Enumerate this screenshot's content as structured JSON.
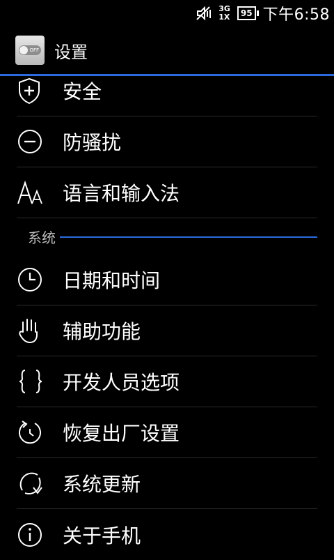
{
  "status_bar": {
    "network_top": "3G",
    "network_bottom": "1X",
    "battery": "95",
    "time": "下午6:58"
  },
  "header": {
    "title": "设置",
    "app_icon_text": "OFF"
  },
  "list_top": [
    {
      "label": "安全",
      "icon": "shield-plus-icon"
    },
    {
      "label": "防骚扰",
      "icon": "minus-circle-icon"
    },
    {
      "label": "语言和输入法",
      "icon": "text-aa-icon"
    }
  ],
  "section": {
    "label": "系统"
  },
  "list_system": [
    {
      "label": "日期和时间",
      "icon": "clock-icon"
    },
    {
      "label": "辅助功能",
      "icon": "hand-icon"
    },
    {
      "label": "开发人员选项",
      "icon": "braces-icon"
    },
    {
      "label": "恢复出厂设置",
      "icon": "reset-icon"
    },
    {
      "label": "系统更新",
      "icon": "update-icon"
    },
    {
      "label": "关于手机",
      "icon": "info-icon"
    }
  ],
  "colors": {
    "accent": "#2b6bdf",
    "background": "#000000",
    "divider": "#2b2b2b"
  }
}
